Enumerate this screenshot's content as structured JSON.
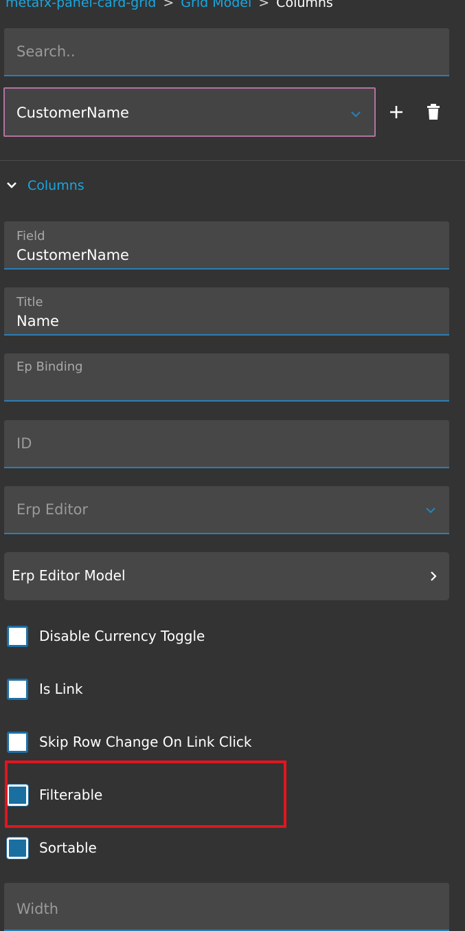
{
  "breadcrumb": {
    "items": [
      "metafx-panel-card-grid",
      "Grid Model"
    ],
    "current": "Columns",
    "separator": ">"
  },
  "search": {
    "placeholder": "Search.."
  },
  "column_selector": {
    "value": "CustomerName"
  },
  "actions": {
    "add_icon": "plus-icon",
    "delete_icon": "trash-icon"
  },
  "section": {
    "title": "Columns"
  },
  "fields": {
    "field": {
      "label": "Field",
      "value": "CustomerName"
    },
    "title": {
      "label": "Title",
      "value": "Name"
    },
    "ep_binding": {
      "label": "Ep Binding",
      "value": ""
    },
    "id": {
      "placeholder": "ID"
    },
    "erp_editor": {
      "placeholder": "Erp Editor"
    },
    "width": {
      "placeholder": "Width"
    }
  },
  "erp_editor_model": {
    "label": "Erp Editor Model"
  },
  "checkboxes": [
    {
      "label": "Disable Currency Toggle"
    },
    {
      "label": "Is Link"
    },
    {
      "label": "Skip Row Change On Link Click"
    },
    {
      "label": "Filterable"
    },
    {
      "label": "Sortable"
    }
  ],
  "colors": {
    "background": "#333333",
    "field_bg": "#474747",
    "accent": "#1aa7e0",
    "underline": "#2a7fb8",
    "selector_border": "#b274a0",
    "highlight": "#e0161f"
  }
}
